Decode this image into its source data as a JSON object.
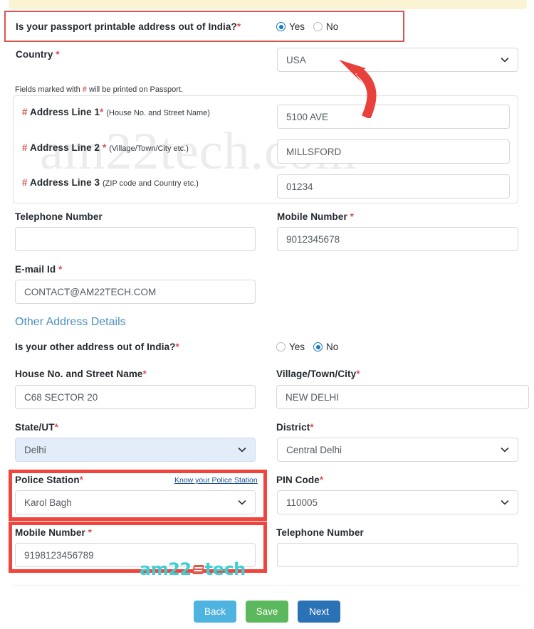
{
  "banner": {
    "present": true,
    "color": "#faf3d4"
  },
  "watermark": {
    "text": "am22tech.com"
  },
  "passport_address": {
    "question_label": "Is your passport printable address out of India?",
    "required_mark": "*",
    "options": [
      {
        "label": "Yes",
        "selected": true
      },
      {
        "label": "No",
        "selected": false
      }
    ],
    "country": {
      "label": "Country",
      "required_mark": "*",
      "value": "USA",
      "icon": "chevron-down-icon"
    },
    "note": "Fields marked with # will be printed on Passport.",
    "note_hash": "#",
    "address_lines": [
      {
        "hash": "#",
        "label": "Address Line 1",
        "required_mark": "*",
        "hint": "(House No. and Street Name)",
        "value": "5100 AVE"
      },
      {
        "hash": "#",
        "label": "Address Line 2",
        "required_mark": "*",
        "hint": "(Village/Town/City etc.)",
        "value": "MILLSFORD"
      },
      {
        "hash": "#",
        "label": "Address Line 3",
        "required_mark": "",
        "hint": "(ZIP code and Country etc.)",
        "value": "01234"
      }
    ],
    "telephone": {
      "label": "Telephone Number",
      "required_mark": "",
      "value": ""
    },
    "mobile": {
      "label": "Mobile Number",
      "required_mark": "*",
      "value": "9012345678"
    },
    "email": {
      "label": "E-mail Id",
      "required_mark": "*",
      "value": "CONTACT@AM22TECH.COM"
    }
  },
  "other_address": {
    "heading": "Other Address Details",
    "question_label": "Is your other address out of India?",
    "required_mark": "*",
    "options": [
      {
        "label": "Yes",
        "selected": false
      },
      {
        "label": "No",
        "selected": true
      }
    ],
    "house_street": {
      "label": "House No. and Street Name",
      "required_mark": "*",
      "value": "C68 SECTOR 20"
    },
    "village_city": {
      "label": "Village/Town/City",
      "required_mark": "*",
      "value": "NEW DELHI"
    },
    "state": {
      "label": "State/UT",
      "required_mark": "*",
      "value": "Delhi",
      "icon": "chevron-down-icon",
      "highlighted": true
    },
    "district": {
      "label": "District",
      "required_mark": "*",
      "value": "Central Delhi",
      "icon": "chevron-down-icon"
    },
    "police_station": {
      "label": "Police Station",
      "required_mark": "*",
      "link_text": "Know your Police Station",
      "value": "Karol Bagh",
      "icon": "chevron-down-icon"
    },
    "pin_code": {
      "label": "PIN Code",
      "required_mark": "*",
      "value": "110005",
      "icon": "chevron-down-icon"
    },
    "mobile": {
      "label": "Mobile Number",
      "required_mark": "*",
      "value": "9198123456789"
    },
    "telephone": {
      "label": "Telephone Number",
      "required_mark": "",
      "value": ""
    }
  },
  "logo": {
    "text_left": "am22",
    "text_right": "tech",
    "icon": "book-icon",
    "color": "#3ecfd3"
  },
  "annotations": {
    "arrow_color": "#e8413c",
    "highlight_color_thin": "#d9534f",
    "highlight_color_thick": "#f0443c"
  },
  "footer_buttons": [
    {
      "label": "Back",
      "color": "#4eb3df"
    },
    {
      "label": "Save",
      "color": "#5cb85c"
    },
    {
      "label": "Next",
      "color": "#2a72b5"
    }
  ]
}
